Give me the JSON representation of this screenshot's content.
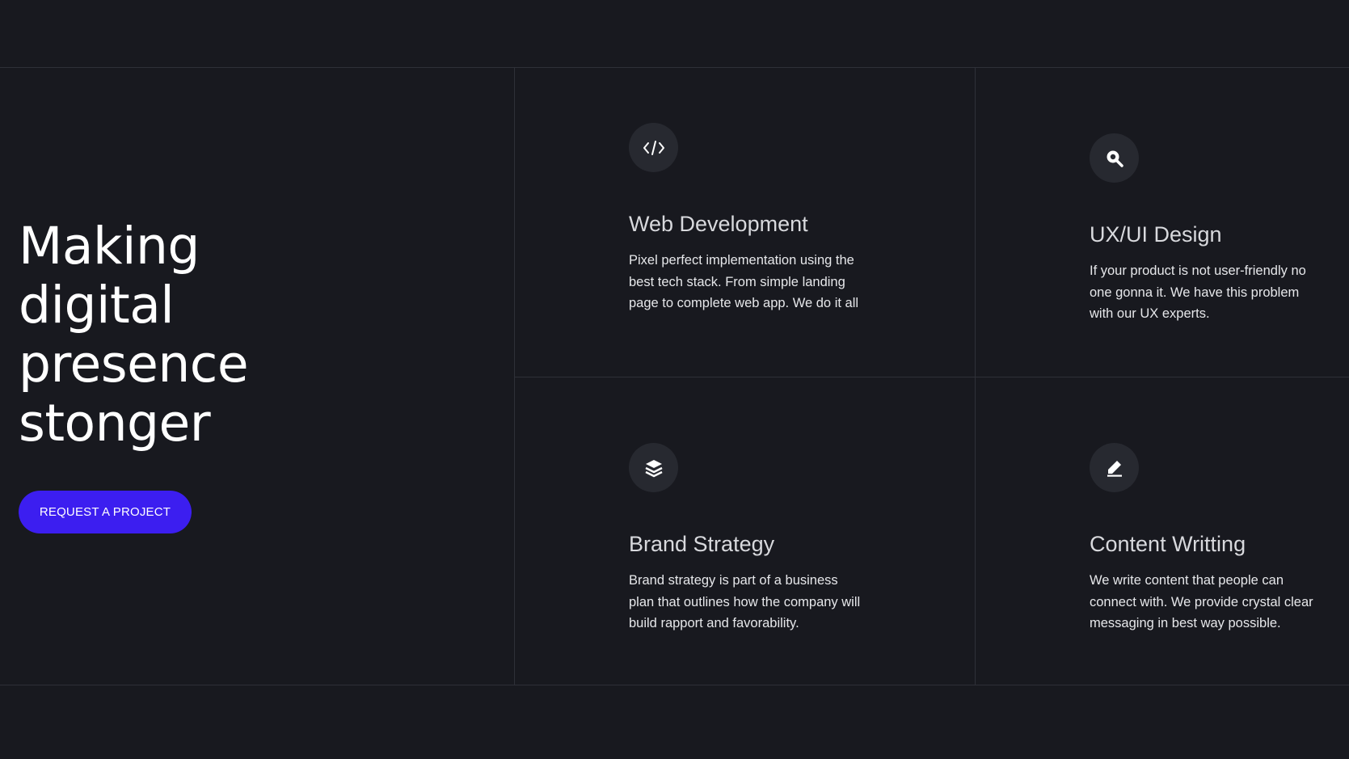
{
  "hero": {
    "title_lines": [
      "Making",
      "digital",
      "presence",
      "stonger"
    ],
    "cta_label": "REQUEST A PROJECT"
  },
  "services": [
    {
      "icon": "code-icon",
      "title": "Web Development",
      "description": "Pixel perfect implementation using the best tech stack. From simple landing page to complete web app. We do it all"
    },
    {
      "icon": "search-icon",
      "title": "UX/UI Design",
      "description": "If your product is not user-friendly no one gonna it. We have this problem with our UX experts."
    },
    {
      "icon": "layers-icon",
      "title": "Brand Strategy",
      "description": "Brand strategy is part of a business plan that outlines how the company will build rapport and favorability."
    },
    {
      "icon": "pencil-icon",
      "title": "Content Writting",
      "description": "We write content that people can connect with. We provide crystal clear messaging in best way possible."
    }
  ],
  "colors": {
    "background": "#18191f",
    "accent": "#3c1ef0",
    "divider": "#2e3038",
    "icon_bg": "#272930"
  }
}
